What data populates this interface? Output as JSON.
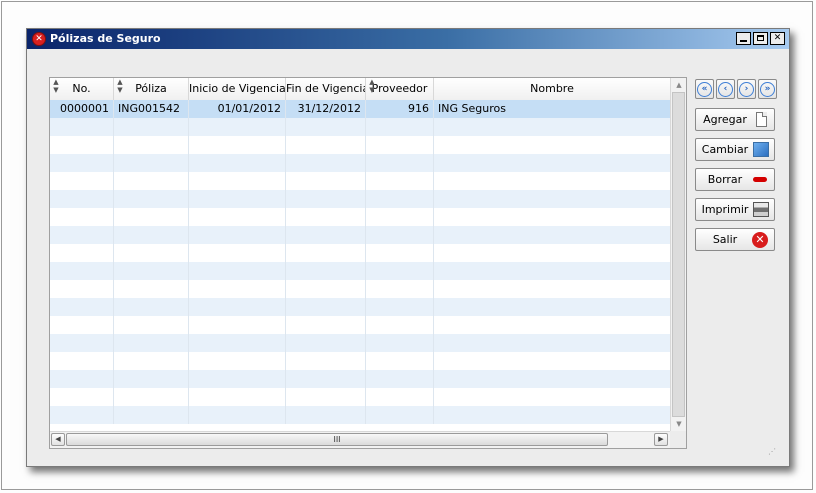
{
  "window": {
    "title": "Pólizas de Seguro"
  },
  "grid": {
    "columns": [
      {
        "label": "No.",
        "sortable": true
      },
      {
        "label": "Póliza",
        "sortable": true
      },
      {
        "label": "Inicio de Vigencia",
        "sortable": false
      },
      {
        "label": "Fin de Vigencia",
        "sortable": false
      },
      {
        "label": "Proveedor",
        "sortable": true
      },
      {
        "label": "Nombre",
        "sortable": false
      }
    ],
    "rows": [
      {
        "no": "0000001",
        "poliza": "ING001542",
        "inicio": "01/01/2012",
        "fin": "31/12/2012",
        "proveedor": "916",
        "nombre": "ING Seguros",
        "selected": true
      }
    ],
    "empty_rows": 17,
    "hscroll_thumb_label": "III"
  },
  "nav_icons": [
    "first-record-icon",
    "previous-record-icon",
    "next-record-icon",
    "last-record-icon"
  ],
  "actions": {
    "agregar": "Agregar",
    "cambiar": "Cambiar",
    "borrar": "Borrar",
    "imprimir": "Imprimir",
    "salir": "Salir"
  },
  "colors": {
    "title_gradient_start": "#0a246a",
    "title_gradient_end": "#a6caf0",
    "selected_row": "#c5def5",
    "alt_row": "#e8f1fa",
    "nav_icon": "#1f60c0",
    "delete_icon": "#d40000"
  }
}
